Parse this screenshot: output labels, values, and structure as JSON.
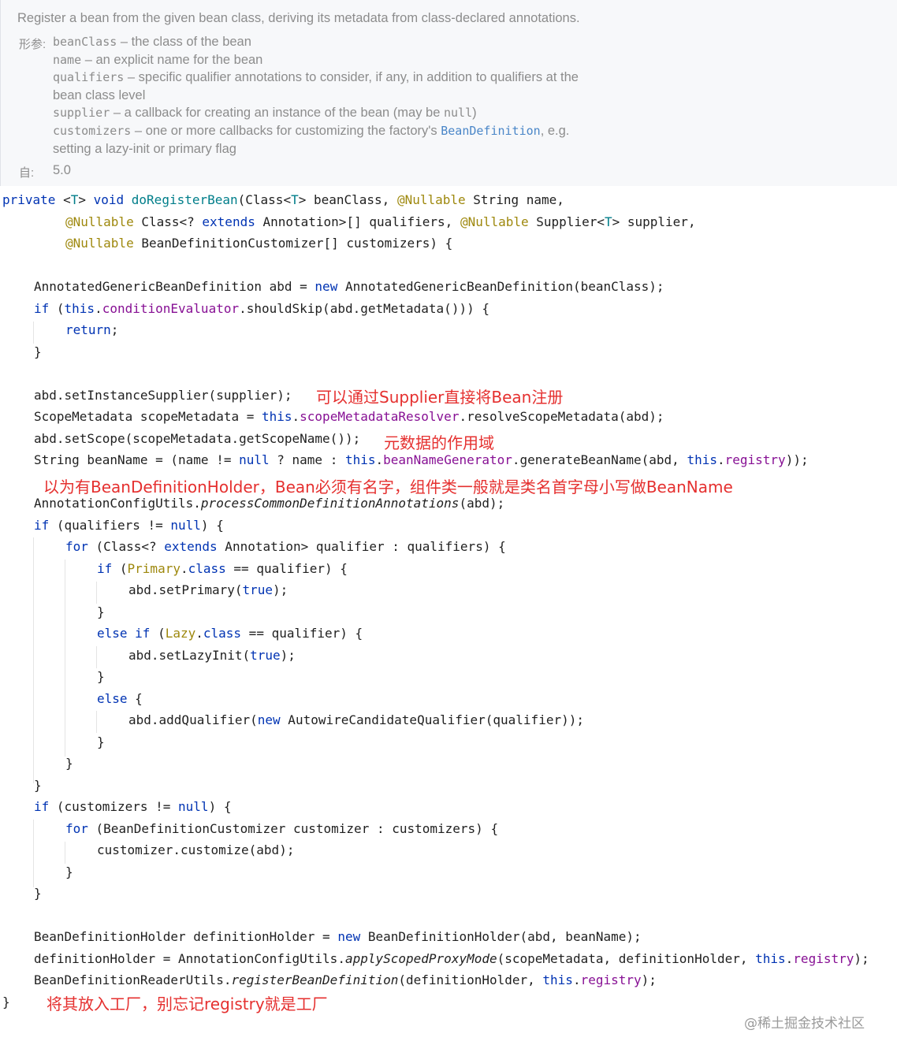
{
  "doc": {
    "summary": "Register a bean from the given bean class, deriving its metadata from class-declared annotations.",
    "params_tag": "形参:",
    "params": [
      {
        "name": "beanClass",
        "text": " – the class of the bean"
      },
      {
        "name": "name",
        "text": " – an explicit name for the bean"
      },
      {
        "name": "qualifiers",
        "text": " – specific qualifier annotations to consider, if any, in addition to qualifiers at the"
      },
      {
        "name": "",
        "text": "bean class level"
      },
      {
        "name": "supplier",
        "text": " – a callback for creating an instance of the bean (may be "
      },
      {
        "name": "customizers",
        "text": " – one or more callbacks for customizing the factory's "
      },
      {
        "name": "",
        "text": "setting a lazy-init or primary flag"
      }
    ],
    "supplier_null": "null",
    "supplier_close": ")",
    "customizers_link": "BeanDefinition",
    "customizers_tail": ", e.g.",
    "since_tag": "自:",
    "since_value": "5.0"
  },
  "notes": {
    "supplier": "可以通过Supplier直接将Bean注册",
    "scope": "元数据的作用域",
    "holder": "以为有BeanDefinitionHolder，Bean必须有名字，组件类一般就是类名首字母小写做BeanName",
    "register": "将其放入工厂，别忘记registry就是工厂"
  },
  "watermark": "@稀土掘金技术社区"
}
